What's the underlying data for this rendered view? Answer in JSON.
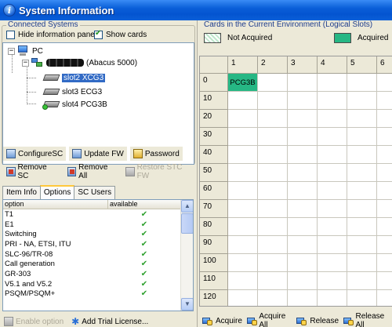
{
  "window": {
    "title": "System Information"
  },
  "connected": {
    "group_label": "Connected Systems",
    "hide_pane_label": "Hide information pane",
    "hide_pane_checked": false,
    "show_cards_label": "Show cards",
    "show_cards_checked": true
  },
  "tree": {
    "root_label": "PC",
    "system_label": "(Abacus 5000)",
    "slots": [
      {
        "label": "slot2 XCG3",
        "selected": true
      },
      {
        "label": "slot3 ECG3",
        "selected": false
      },
      {
        "label": "slot4 PCG3B",
        "selected": false
      }
    ]
  },
  "toolbar": {
    "configure_sc": "ConfigureSC",
    "update_fw": "Update FW",
    "password": "Password",
    "remove_sc": "Remove SC",
    "remove_all": "Remove All",
    "restore_stc_fw": "Restore STC FW"
  },
  "tabs": [
    "Item Info",
    "Options",
    "SC Users"
  ],
  "options_table": {
    "col_option": "option",
    "col_available": "available",
    "rows": [
      {
        "option": "T1",
        "available": "✔"
      },
      {
        "option": "E1",
        "available": "✔"
      },
      {
        "option": "Switching",
        "available": "✔"
      },
      {
        "option": "PRI - NA, ETSI, ITU",
        "available": "✔"
      },
      {
        "option": "SLC-96/TR-08",
        "available": "✔"
      },
      {
        "option": "Call generation",
        "available": "✔"
      },
      {
        "option": "GR-303",
        "available": "✔"
      },
      {
        "option": "V5.1 and V5.2",
        "available": "✔"
      },
      {
        "option": "PSQM/PSQM+",
        "available": "✔"
      }
    ]
  },
  "bottom_left": {
    "enable_option": "Enable option",
    "add_trial": "Add Trial License..."
  },
  "cards": {
    "group_label": "Cards in the Current Environment (Logical Slots)",
    "legend_not_acquired": "Not Acquired",
    "legend_acquired": "Acquired",
    "acquired_color": "#26b784",
    "columns": [
      "1",
      "2",
      "3",
      "4",
      "5",
      "6"
    ],
    "rows": [
      "0",
      "10",
      "20",
      "30",
      "40",
      "50",
      "60",
      "70",
      "80",
      "90",
      "100",
      "110",
      "120"
    ],
    "placed": [
      {
        "row": 0,
        "col": 0,
        "label": "PCG3B"
      }
    ]
  },
  "bottom_right": {
    "acquire": "Acquire",
    "acquire_all": "Acquire All",
    "release": "Release",
    "release_all": "Release All"
  }
}
